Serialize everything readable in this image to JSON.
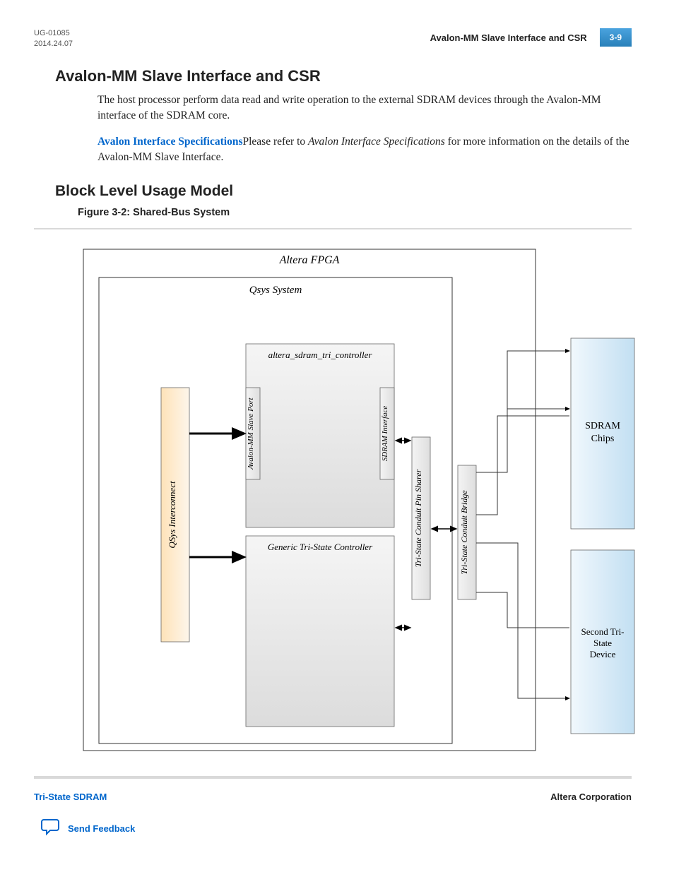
{
  "header": {
    "doc_id": "UG-01085",
    "date": "2014.24.07",
    "right_title": "Avalon-MM Slave Interface and CSR",
    "page_num": "3-9"
  },
  "section1": {
    "title": "Avalon-MM Slave Interface and CSR",
    "para1": "The host processor perform data read and write operation to the external SDRAM devices through the Avalon-MM interface of the SDRAM core.",
    "link_text": "Avalon Interface Specifications",
    "para2_a": "Please refer to ",
    "para2_italic": "Avalon Interface Specifications",
    "para2_b": " for more information on the details of the Avalon-MM Slave Interface."
  },
  "section2": {
    "title": "Block Level Usage Model",
    "figure_caption": "Figure 3-2: Shared-Bus System"
  },
  "diagram": {
    "outer": "Altera FPGA",
    "qsys": "Qsys System",
    "controller": "altera_sdram_tri_controller",
    "slave_port": "Avalon-MM Slave Port",
    "sdram_if": "SDRAM Interface",
    "interconnect": "QSys Interconnect",
    "generic": "Generic Tri-State Controller",
    "pin_sharer": "Tri-State Conduit Pin Sharer",
    "bridge": "Tri-State Conduit Bridge",
    "sdram_chips_1": "SDRAM",
    "sdram_chips_2": "Chips",
    "second_1": "Second Tri-",
    "second_2": "State",
    "second_3": "Device"
  },
  "footer": {
    "left": "Tri-State SDRAM",
    "right": "Altera Corporation",
    "feedback": "Send Feedback"
  }
}
